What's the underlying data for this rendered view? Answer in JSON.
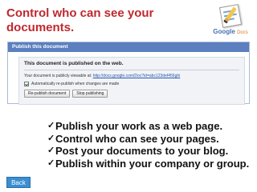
{
  "slide": {
    "title": "Control who can see your documents."
  },
  "logo": {
    "brand": "Google",
    "product": "Docs"
  },
  "publish_panel": {
    "header": "Publish this document",
    "status_heading": "This document is published on the web.",
    "url_prefix": "Your document is publicly viewable at:",
    "url": "http://docs.google.com/Doc?id=abc123def456ghi",
    "auto_republish": {
      "checked": true,
      "label": "Automatically re-publish when changes are made"
    },
    "buttons": {
      "republish": "Re-publish document",
      "stop": "Stop publishing"
    }
  },
  "bullets": [
    "Publish your work as a web page.",
    "Control who can see your pages.",
    "Post your documents to your blog.",
    "Publish within your company or group."
  ],
  "nav": {
    "back": "Back"
  },
  "colors": {
    "title": "#c0282e",
    "panel_header": "#5b7fbf",
    "back_button": "#3a8ed1"
  }
}
